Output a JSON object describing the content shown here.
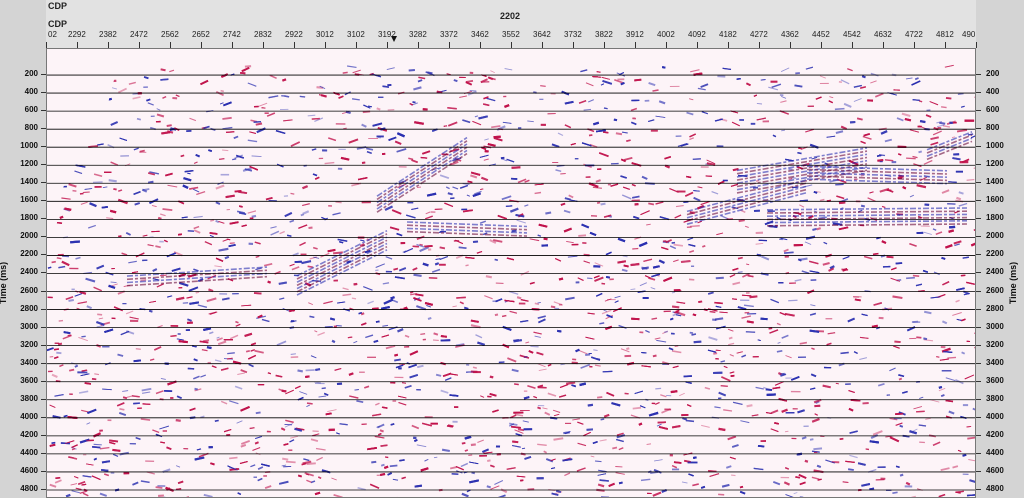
{
  "header": {
    "row1_label": "CDP",
    "row2_label": "CDP",
    "center_value": "2202"
  },
  "colors": {
    "background": "#fdf4f8",
    "positive": "#c0104a",
    "negative": "#2a2fb0",
    "strong": "#6a0a3a",
    "gridline": "#000000"
  },
  "chart_data": {
    "type": "heatmap",
    "title": "",
    "xlabel": "CDP",
    "ylabel": "Time (ms)",
    "x_ticks": [
      "02",
      "2292",
      "2382",
      "2472",
      "2562",
      "2652",
      "2742",
      "2832",
      "2922",
      "3012",
      "3102",
      "3192",
      "3282",
      "3372",
      "3462",
      "3552",
      "3642",
      "3732",
      "3822",
      "3912",
      "4002",
      "4092",
      "4182",
      "4272",
      "4362",
      "4452",
      "4542",
      "4632",
      "4722",
      "4812",
      "490"
    ],
    "y_ticks": [
      200,
      400,
      600,
      800,
      1000,
      1200,
      1400,
      1600,
      1800,
      2000,
      2200,
      2400,
      2600,
      2800,
      3000,
      3200,
      3400,
      3600,
      3800,
      4000,
      4200,
      4400,
      4600,
      4800
    ],
    "ylim": [
      0,
      4900
    ],
    "grid": true
  }
}
